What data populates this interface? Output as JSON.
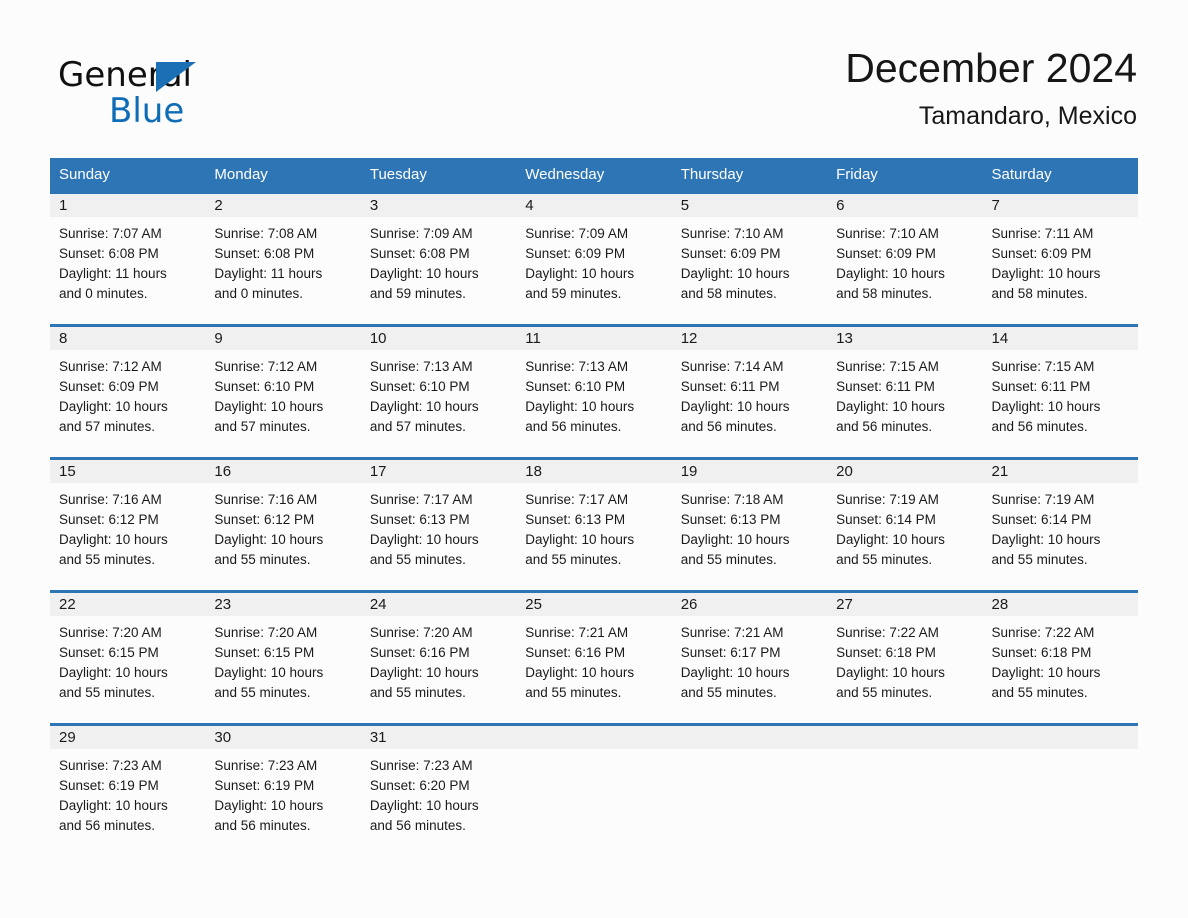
{
  "logo": {
    "word_one": "General",
    "word_two": "Blue",
    "triangle_color": "#1b6fb5",
    "word_two_color": "#0f6cb6"
  },
  "header": {
    "title": "December 2024",
    "subtitle": "Tamandaro, Mexico"
  },
  "theme": {
    "header_blue": "#2e75b6",
    "rule_blue": "#2e75b6",
    "daynum_bg": "#f0f0f0",
    "page_bg": "#fcfcfc"
  },
  "weekdays": [
    "Sunday",
    "Monday",
    "Tuesday",
    "Wednesday",
    "Thursday",
    "Friday",
    "Saturday"
  ],
  "weeks": [
    [
      {
        "day": "1",
        "sunrise": "Sunrise: 7:07 AM",
        "sunset": "Sunset: 6:08 PM",
        "daylight_1": "Daylight: 11 hours",
        "daylight_2": "and 0 minutes."
      },
      {
        "day": "2",
        "sunrise": "Sunrise: 7:08 AM",
        "sunset": "Sunset: 6:08 PM",
        "daylight_1": "Daylight: 11 hours",
        "daylight_2": "and 0 minutes."
      },
      {
        "day": "3",
        "sunrise": "Sunrise: 7:09 AM",
        "sunset": "Sunset: 6:08 PM",
        "daylight_1": "Daylight: 10 hours",
        "daylight_2": "and 59 minutes."
      },
      {
        "day": "4",
        "sunrise": "Sunrise: 7:09 AM",
        "sunset": "Sunset: 6:09 PM",
        "daylight_1": "Daylight: 10 hours",
        "daylight_2": "and 59 minutes."
      },
      {
        "day": "5",
        "sunrise": "Sunrise: 7:10 AM",
        "sunset": "Sunset: 6:09 PM",
        "daylight_1": "Daylight: 10 hours",
        "daylight_2": "and 58 minutes."
      },
      {
        "day": "6",
        "sunrise": "Sunrise: 7:10 AM",
        "sunset": "Sunset: 6:09 PM",
        "daylight_1": "Daylight: 10 hours",
        "daylight_2": "and 58 minutes."
      },
      {
        "day": "7",
        "sunrise": "Sunrise: 7:11 AM",
        "sunset": "Sunset: 6:09 PM",
        "daylight_1": "Daylight: 10 hours",
        "daylight_2": "and 58 minutes."
      }
    ],
    [
      {
        "day": "8",
        "sunrise": "Sunrise: 7:12 AM",
        "sunset": "Sunset: 6:09 PM",
        "daylight_1": "Daylight: 10 hours",
        "daylight_2": "and 57 minutes."
      },
      {
        "day": "9",
        "sunrise": "Sunrise: 7:12 AM",
        "sunset": "Sunset: 6:10 PM",
        "daylight_1": "Daylight: 10 hours",
        "daylight_2": "and 57 minutes."
      },
      {
        "day": "10",
        "sunrise": "Sunrise: 7:13 AM",
        "sunset": "Sunset: 6:10 PM",
        "daylight_1": "Daylight: 10 hours",
        "daylight_2": "and 57 minutes."
      },
      {
        "day": "11",
        "sunrise": "Sunrise: 7:13 AM",
        "sunset": "Sunset: 6:10 PM",
        "daylight_1": "Daylight: 10 hours",
        "daylight_2": "and 56 minutes."
      },
      {
        "day": "12",
        "sunrise": "Sunrise: 7:14 AM",
        "sunset": "Sunset: 6:11 PM",
        "daylight_1": "Daylight: 10 hours",
        "daylight_2": "and 56 minutes."
      },
      {
        "day": "13",
        "sunrise": "Sunrise: 7:15 AM",
        "sunset": "Sunset: 6:11 PM",
        "daylight_1": "Daylight: 10 hours",
        "daylight_2": "and 56 minutes."
      },
      {
        "day": "14",
        "sunrise": "Sunrise: 7:15 AM",
        "sunset": "Sunset: 6:11 PM",
        "daylight_1": "Daylight: 10 hours",
        "daylight_2": "and 56 minutes."
      }
    ],
    [
      {
        "day": "15",
        "sunrise": "Sunrise: 7:16 AM",
        "sunset": "Sunset: 6:12 PM",
        "daylight_1": "Daylight: 10 hours",
        "daylight_2": "and 55 minutes."
      },
      {
        "day": "16",
        "sunrise": "Sunrise: 7:16 AM",
        "sunset": "Sunset: 6:12 PM",
        "daylight_1": "Daylight: 10 hours",
        "daylight_2": "and 55 minutes."
      },
      {
        "day": "17",
        "sunrise": "Sunrise: 7:17 AM",
        "sunset": "Sunset: 6:13 PM",
        "daylight_1": "Daylight: 10 hours",
        "daylight_2": "and 55 minutes."
      },
      {
        "day": "18",
        "sunrise": "Sunrise: 7:17 AM",
        "sunset": "Sunset: 6:13 PM",
        "daylight_1": "Daylight: 10 hours",
        "daylight_2": "and 55 minutes."
      },
      {
        "day": "19",
        "sunrise": "Sunrise: 7:18 AM",
        "sunset": "Sunset: 6:13 PM",
        "daylight_1": "Daylight: 10 hours",
        "daylight_2": "and 55 minutes."
      },
      {
        "day": "20",
        "sunrise": "Sunrise: 7:19 AM",
        "sunset": "Sunset: 6:14 PM",
        "daylight_1": "Daylight: 10 hours",
        "daylight_2": "and 55 minutes."
      },
      {
        "day": "21",
        "sunrise": "Sunrise: 7:19 AM",
        "sunset": "Sunset: 6:14 PM",
        "daylight_1": "Daylight: 10 hours",
        "daylight_2": "and 55 minutes."
      }
    ],
    [
      {
        "day": "22",
        "sunrise": "Sunrise: 7:20 AM",
        "sunset": "Sunset: 6:15 PM",
        "daylight_1": "Daylight: 10 hours",
        "daylight_2": "and 55 minutes."
      },
      {
        "day": "23",
        "sunrise": "Sunrise: 7:20 AM",
        "sunset": "Sunset: 6:15 PM",
        "daylight_1": "Daylight: 10 hours",
        "daylight_2": "and 55 minutes."
      },
      {
        "day": "24",
        "sunrise": "Sunrise: 7:20 AM",
        "sunset": "Sunset: 6:16 PM",
        "daylight_1": "Daylight: 10 hours",
        "daylight_2": "and 55 minutes."
      },
      {
        "day": "25",
        "sunrise": "Sunrise: 7:21 AM",
        "sunset": "Sunset: 6:16 PM",
        "daylight_1": "Daylight: 10 hours",
        "daylight_2": "and 55 minutes."
      },
      {
        "day": "26",
        "sunrise": "Sunrise: 7:21 AM",
        "sunset": "Sunset: 6:17 PM",
        "daylight_1": "Daylight: 10 hours",
        "daylight_2": "and 55 minutes."
      },
      {
        "day": "27",
        "sunrise": "Sunrise: 7:22 AM",
        "sunset": "Sunset: 6:18 PM",
        "daylight_1": "Daylight: 10 hours",
        "daylight_2": "and 55 minutes."
      },
      {
        "day": "28",
        "sunrise": "Sunrise: 7:22 AM",
        "sunset": "Sunset: 6:18 PM",
        "daylight_1": "Daylight: 10 hours",
        "daylight_2": "and 55 minutes."
      }
    ],
    [
      {
        "day": "29",
        "sunrise": "Sunrise: 7:23 AM",
        "sunset": "Sunset: 6:19 PM",
        "daylight_1": "Daylight: 10 hours",
        "daylight_2": "and 56 minutes."
      },
      {
        "day": "30",
        "sunrise": "Sunrise: 7:23 AM",
        "sunset": "Sunset: 6:19 PM",
        "daylight_1": "Daylight: 10 hours",
        "daylight_2": "and 56 minutes."
      },
      {
        "day": "31",
        "sunrise": "Sunrise: 7:23 AM",
        "sunset": "Sunset: 6:20 PM",
        "daylight_1": "Daylight: 10 hours",
        "daylight_2": "and 56 minutes."
      },
      {
        "day": "",
        "sunrise": "",
        "sunset": "",
        "daylight_1": "",
        "daylight_2": ""
      },
      {
        "day": "",
        "sunrise": "",
        "sunset": "",
        "daylight_1": "",
        "daylight_2": ""
      },
      {
        "day": "",
        "sunrise": "",
        "sunset": "",
        "daylight_1": "",
        "daylight_2": ""
      },
      {
        "day": "",
        "sunrise": "",
        "sunset": "",
        "daylight_1": "",
        "daylight_2": ""
      }
    ]
  ]
}
